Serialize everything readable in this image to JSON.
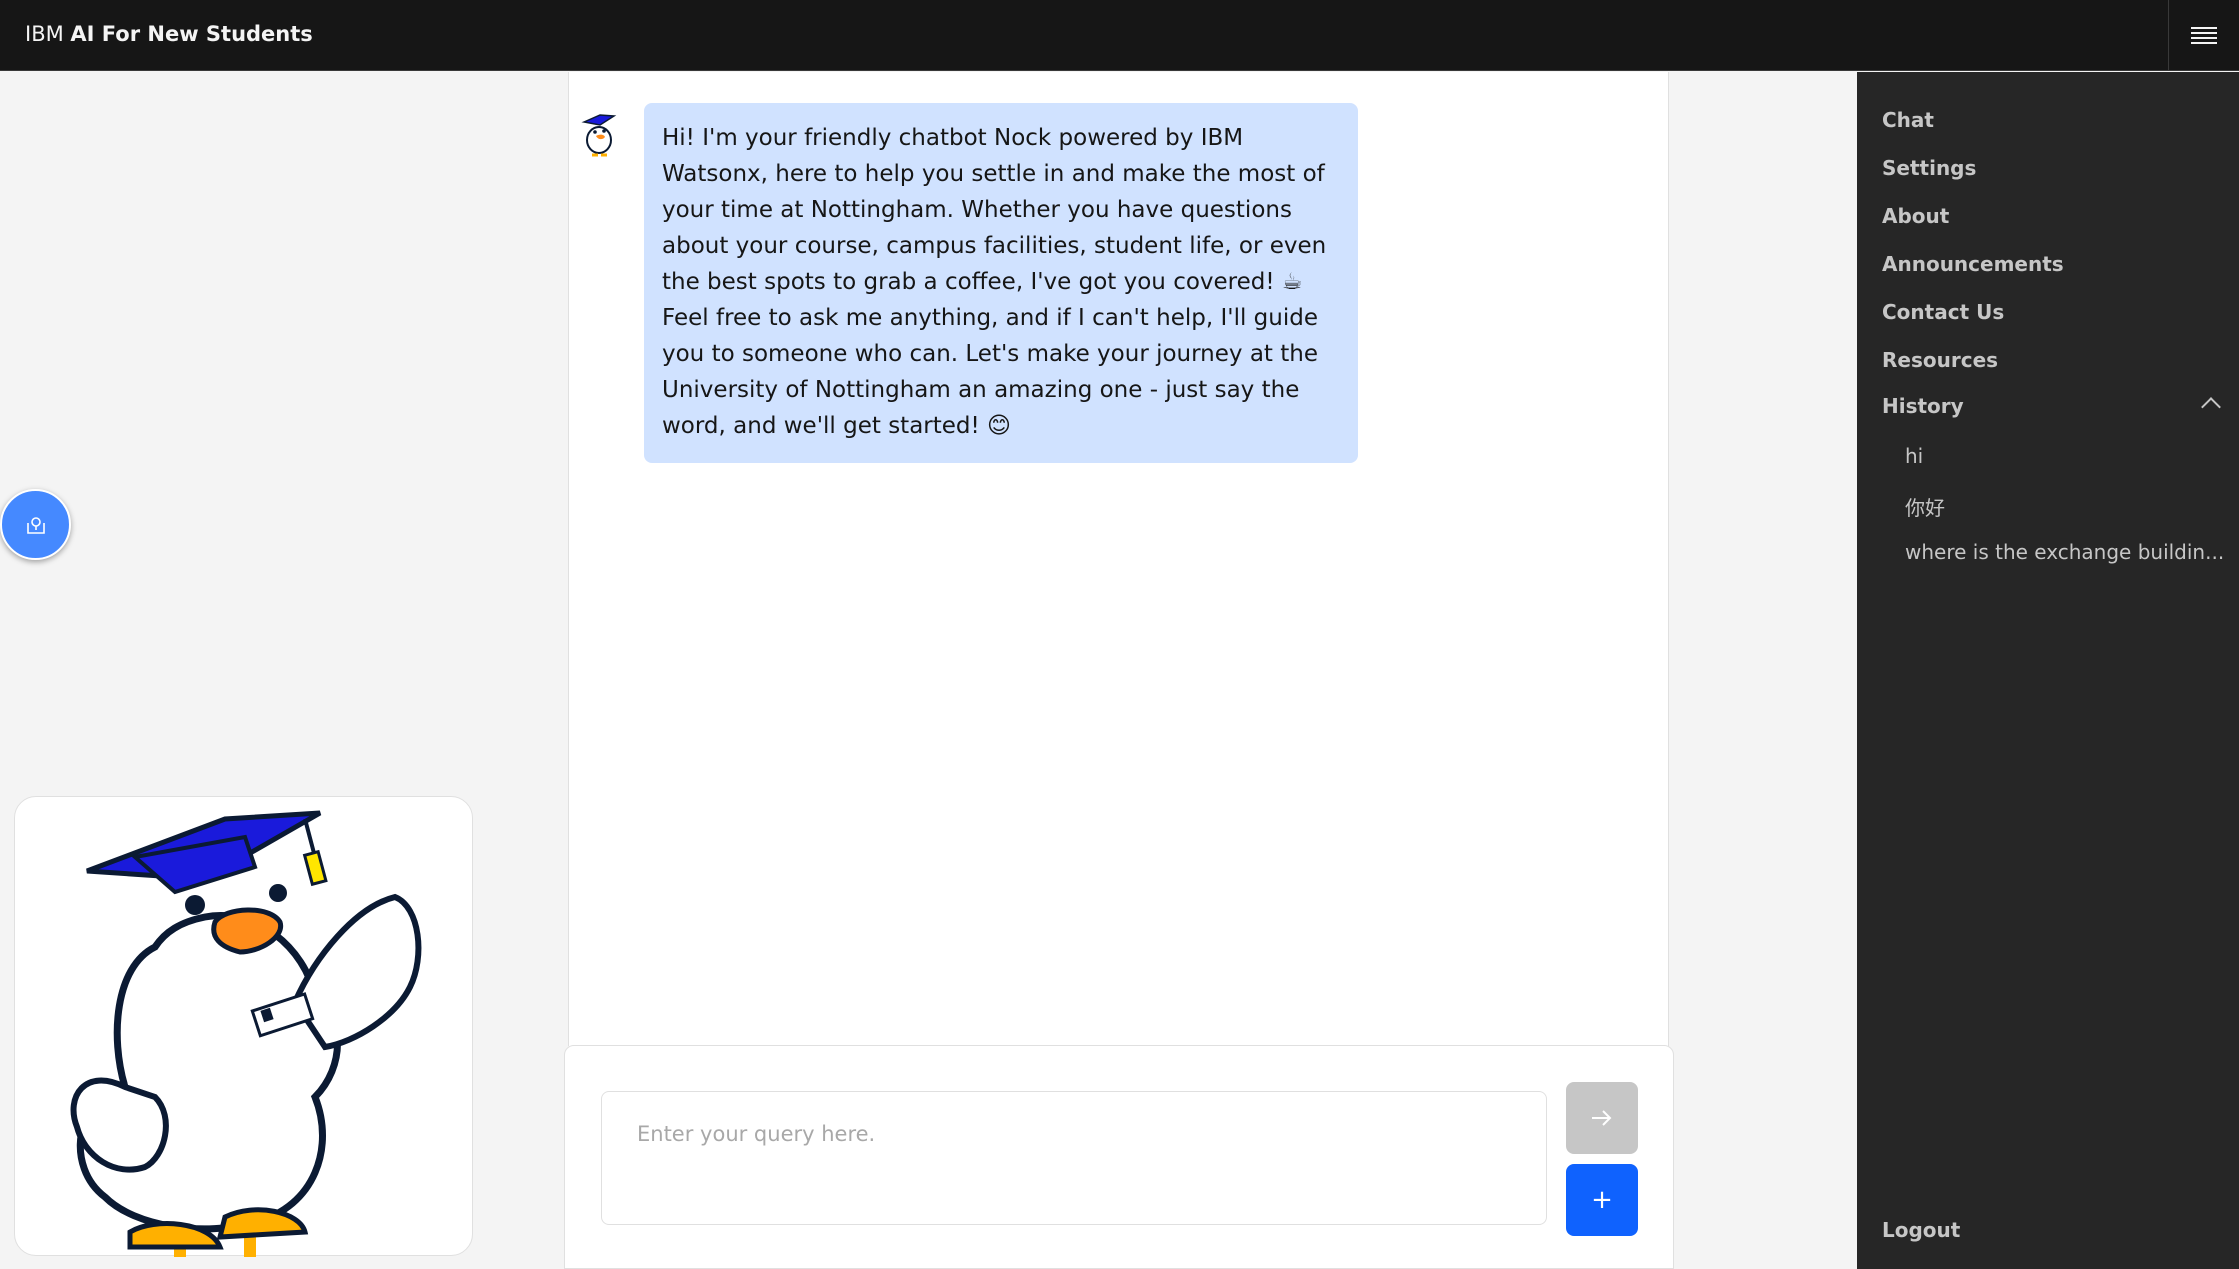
{
  "app": {
    "brand_prefix": "IBM",
    "brand_name": "AI For New Students"
  },
  "header": {
    "menu_icon": "hamburger-menu-icon"
  },
  "sidebar": {
    "items": [
      {
        "label": "Chat"
      },
      {
        "label": "Settings"
      },
      {
        "label": "About"
      },
      {
        "label": "Announcements"
      },
      {
        "label": "Contact Us"
      },
      {
        "label": "Resources"
      }
    ],
    "history": {
      "label": "History",
      "expanded": true,
      "items": [
        {
          "label": "hi"
        },
        {
          "label": "你好"
        },
        {
          "label": "where is the exchange buildin..."
        }
      ]
    },
    "logout_label": "Logout"
  },
  "chat": {
    "messages": [
      {
        "sender": "bot",
        "paragraphs": [
          "Hi! I'm your friendly chatbot Nock powered by IBM Watsonx, here to help you settle in and make the most of your time at Nottingham. Whether you have questions about your course, campus facilities, student life, or even the best spots to grab a coffee, I've got you covered! ☕",
          "Feel free to ask me anything, and if I can't help, I'll guide you to someone who can. Let's make your journey at the University of Nottingham an amazing one - just say the word, and we'll get started! 😊"
        ]
      }
    ]
  },
  "composer": {
    "placeholder": "Enter your query here.",
    "value": "",
    "send_icon": "arrow-right-icon",
    "new_label": "+"
  },
  "floating": {
    "location_icon": "map-pin-icon"
  },
  "colors": {
    "header_bg": "#161616",
    "sidepanel_bg": "#262626",
    "bubble_bg": "#d0e2ff",
    "primary": "#0f62fe",
    "disabled": "#c6c6c6",
    "fab": "#4589ff"
  }
}
